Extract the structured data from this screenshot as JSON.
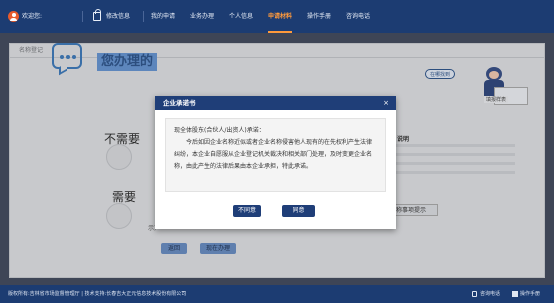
{
  "topbar": {
    "welcome": "欢迎您:",
    "edit_info": "修改信息",
    "nav": [
      "我的申请",
      "业务办理",
      "个人信息",
      "申请材料",
      "操作手册",
      "咨询电话"
    ],
    "active_index": 3
  },
  "panel": {
    "title": "名称登记",
    "headline": "您办理的",
    "choice_no": "不需要",
    "choice_yes": "需要",
    "hint": "示)",
    "back_button": "返回",
    "now_button": "现在办理",
    "right_title": "说明",
    "right_button": "名称事项提示",
    "bubble": "在哪找到",
    "board_label": "填报样表"
  },
  "modal": {
    "title": "企业承诺书",
    "close": "×",
    "salutation": "现全体股东(合伙人/出资人)承诺：",
    "body": "今后如因企业名称近似或者企业名称侵害他人现有的在先权利产生法律纠纷，本企业自愿服从企业登记机关裁决和相关部门处理，及时变更企业名称，由此产生的法律后果由本企业承担，特此承诺。",
    "disagree_button": "不同意",
    "agree_button": "同意"
  },
  "footer": {
    "copyright": "版权所有:吉林省市场监督管理厅 | 技术支持:长春吉大正元信息技术股份有限公司",
    "consult": "咨询电话",
    "manual": "操作手册"
  },
  "colors": {
    "nav_bg": "#1c3c72",
    "active": "#ff9a3c",
    "modal_head": "#1f3e78"
  }
}
